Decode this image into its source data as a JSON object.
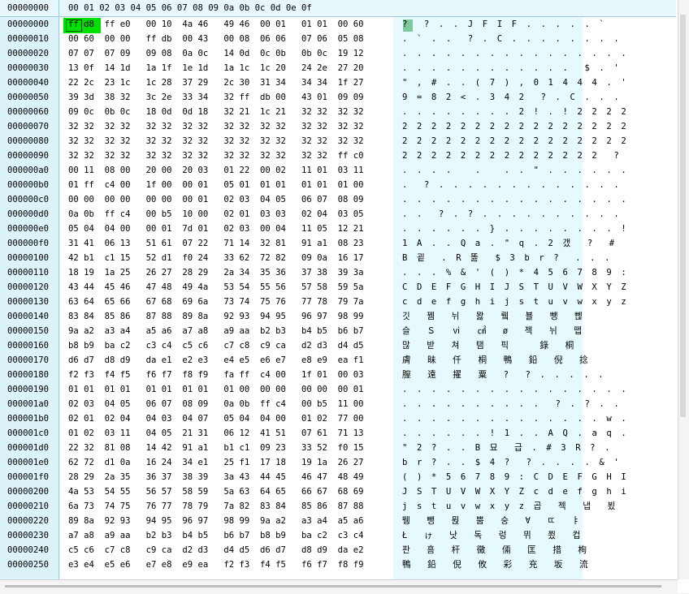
{
  "header": {
    "offset_label": "00000000",
    "columns": "00 01  02 03   04 05  06 07   08 09  0a 0b   0c 0d  0e 0f"
  },
  "selection": {
    "byte": "ff"
  },
  "rows": [
    {
      "off": "00000000",
      "hex": "ff d8  ff e0   00 10  4a 46   49 46  00 01   01 01  00 60",
      "asc": "?  ? . . J F I F . . . . . `"
    },
    {
      "off": "00000010",
      "hex": "00 60  00 00   ff db  00 43   00 08  06 06   07 06  05 08",
      "asc": ". ` . .  ? . C . . . . . . . ."
    },
    {
      "off": "00000020",
      "hex": "07 07  07 09   09 08  0a 0c   14 0d  0c 0b   0b 0c  19 12",
      "asc": ". . . . . . . . . . . . . . . ."
    },
    {
      "off": "00000030",
      "hex": "13 0f  14 1d   1a 1f  1e 1d   1a 1c  1c 20   24 2e  27 20",
      "asc": ". . . . . . . . . . . .  $ . '"
    },
    {
      "off": "00000040",
      "hex": "22 2c  23 1c   1c 28  37 29   2c 30  31 34   34 34  1f 27",
      "asc": "\" , # . . ( 7 ) , 0 1 4 4 4 . '"
    },
    {
      "off": "00000050",
      "hex": "39 3d  38 32   3c 2e  33 34   32 ff  db 00   43 01  09 09",
      "asc": "9 = 8 2 < . 3 4 2  ? . C . . ."
    },
    {
      "off": "00000060",
      "hex": "09 0c  0b 0c   18 0d  0d 18   32 21  1c 21   32 32  32 32",
      "asc": ". . . . . . . . 2 ! . ! 2 2 2 2"
    },
    {
      "off": "00000070",
      "hex": "32 32  32 32   32 32  32 32   32 32  32 32   32 32  32 32",
      "asc": "2 2 2 2 2 2 2 2 2 2 2 2 2 2 2 2"
    },
    {
      "off": "00000080",
      "hex": "32 32  32 32   32 32  32 32   32 32  32 32   32 32  32 32",
      "asc": "2 2 2 2 2 2 2 2 2 2 2 2 2 2 2 2"
    },
    {
      "off": "00000090",
      "hex": "32 32  32 32   32 32  32 32   32 32  32 32   32 32  ff c0",
      "asc": "2 2 2 2 2 2 2 2 2 2 2 2 2 2  ?"
    },
    {
      "off": "000000a0",
      "hex": "00 11  08 00   20 00  20 03   01 22  00 02   11 01  03 11",
      "asc": ". . . .   .   . . \" . . . . . ."
    },
    {
      "off": "000000b0",
      "hex": "01 ff  c4 00   1f 00  00 01   05 01  01 01   01 01  01 00",
      "asc": ".  ? . . . . . . . . . . . . ."
    },
    {
      "off": "000000c0",
      "hex": "00 00  00 00   00 00  00 01   02 03  04 05   06 07  08 09",
      "asc": ". . . . . . . . . . . . . . . ."
    },
    {
      "off": "000000d0",
      "hex": "0a 0b  ff c4   00 b5  10 00   02 01  03 03   02 04  03 05",
      "asc": ". .  ? . ? . . . . . . . . . ."
    },
    {
      "off": "000000e0",
      "hex": "05 04  04 00   00 01  7d 01   02 03  00 04   11 05  12 21",
      "asc": ". . . . . . } . . . . . . . . !"
    },
    {
      "off": "000000f0",
      "hex": "31 41  06 13   51 61  07 22   71 14  32 81   91 a1  08 23",
      "asc": "1 A . . Q a . \" q . 2 갰  ?  #"
    },
    {
      "off": "00000100",
      "hex": "42 b1  c1 15   52 d1  f0 24   33 62  72 82   09 0a  16 17",
      "asc": "B 굍  . R 똟  $ 3 b r ?  . . ."
    },
    {
      "off": "00000110",
      "hex": "18 19  1a 25   26 27  28 29   2a 34  35 36   37 38  39 3a",
      "asc": ". . . % & ' ( ) * 4 5 6 7 8 9 :"
    },
    {
      "off": "00000120",
      "hex": "43 44  45 46   47 48  49 4a   53 54  55 56   57 58  59 5a",
      "asc": "C D E F G H I J S T U V W X Y Z"
    },
    {
      "off": "00000130",
      "hex": "63 64  65 66   67 68  69 6a   73 74  75 76   77 78  79 7a",
      "asc": "c d e f g h i j s t u v w x y z"
    },
    {
      "off": "00000140",
      "hex": "83 84  85 86   87 88  89 8a   92 93  94 95   96 97  98 99",
      "asc": "깃  뀀  뉘  뫓  뤸  뵬  뺑  뻲"
    },
    {
      "off": "00000150",
      "hex": "9a a2  a3 a4   a5 a6  a7 a8   a9 aa  b2 b3   b4 b5  b6 b7",
      "asc": "슬  Ｓ  ⅵ  ㎠  ø  젝  뉘  뗍"
    },
    {
      "off": "00000160",
      "hex": "b8 b9  ba c2   c3 c4  c5 c6   c7 c8  c9 ca   d2 d3  d4 d5",
      "asc": "많  받  쳐  탬  픽    錄  桐"
    },
    {
      "off": "00000170",
      "hex": "d6 d7  d8 d9   da e1  e2 e3   e4 e5  e6 e7   e8 e9  ea f1",
      "asc": "膚  昧  仟  桐  鴨  鉛  倪  捻"
    },
    {
      "off": "00000180",
      "hex": "f2 f3  f4 f5   f6 f7  f8 f9   fa ff  c4 00   1f 01  00 03",
      "asc": "膣  遠  擢  粟  ?  ? . . . . ."
    },
    {
      "off": "00000190",
      "hex": "01 01  01 01   01 01  01 01   01 00  00 00   00 00  00 01",
      "asc": ". . . . . . . . . . . . . . . ."
    },
    {
      "off": "000001a0",
      "hex": "02 03  04 05   06 07  08 09   0a 0b  ff c4   00 b5  11 00",
      "asc": ". . . . . . . . . .  ? . ? . ."
    },
    {
      "off": "000001b0",
      "hex": "02 01  02 04   04 03  04 07   05 04  04 00   01 02  77 00",
      "asc": ". . . . . . . . . . . . . . w ."
    },
    {
      "off": "000001c0",
      "hex": "01 02  03 11   04 05  21 31   06 12  41 51   07 61  71 13",
      "asc": ". . . . . . ! 1 . . A Q . a q ."
    },
    {
      "off": "000001d0",
      "hex": "22 32  81 08   14 42  91 a1   b1 c1  09 23   33 52  f0 15",
      "asc": "\" 2 ? . . B 묘  급 . # 3 R ? ."
    },
    {
      "off": "000001e0",
      "hex": "62 72  d1 0a   16 24  34 e1   25 f1  17 18   19 1a  26 27",
      "asc": "b r ? . . $ 4 ?  ? . . . . & '"
    },
    {
      "off": "000001f0",
      "hex": "28 29  2a 35   36 37  38 39   3a 43  44 45   46 47  48 49",
      "asc": "( ) * 5 6 7 8 9 : C D E F G H I"
    },
    {
      "off": "00000200",
      "hex": "4a 53  54 55   56 57  58 59   5a 63  64 65   66 67  68 69",
      "asc": "J S T U V W X Y Z c d e f g h i"
    },
    {
      "off": "00000210",
      "hex": "6a 73  74 75   76 77  78 79   7a 82  83 84   85 86  87 88",
      "asc": "j s t u v w x y z 곱  젝  냅  뵜"
    },
    {
      "off": "00000220",
      "hex": "89 8a  92 93   94 95  96 97   98 99  9a a2   a3 a4  a5 a6",
      "asc": "뛩  뺑  뮍  뿜  숭  ∀  ㄸ  ㅑ"
    },
    {
      "off": "00000230",
      "hex": "a7 a8  a9 aa   b2 b3  b4 b5   b6 b7  b8 b9   ba c2  c3 c4",
      "asc": "Ł  ゖ  낫  독  렁  뮈  쬤  컵"
    },
    {
      "off": "00000240",
      "hex": "c5 c6  c7 c8   c9 ca  d2 d3   d4 d5  d6 d7   d8 d9  da e2",
      "asc": "판  흠  杆  黴  倆  匡  措  栒"
    },
    {
      "off": "00000250",
      "hex": "e3 e4  e5 e6   e7 e8  e9 ea   f2 f3  f4 f5   f6 f7  f8 f9",
      "asc": "鴨  鉛  倪  攸  彩  充  坂  流"
    }
  ]
}
